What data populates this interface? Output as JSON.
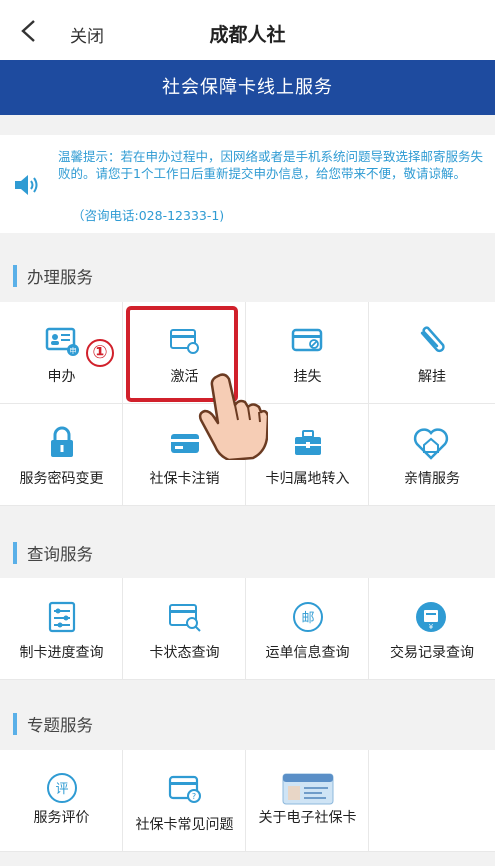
{
  "header": {
    "close_label": "关闭",
    "title": "成都人社"
  },
  "banner": {
    "text": "社会保障卡线上服务"
  },
  "notice": {
    "text": "温馨提示：若在申办过程中，因网络或者是手机系统问题导致选择邮寄服务失败的。请您于1个工作日后重新提交申办信息，给您带来不便，敬请谅解。",
    "tel": "（咨询电话:028-12333-1)"
  },
  "sections": {
    "handle": {
      "title": "办理服务",
      "items": [
        {
          "label": "申办",
          "icon": "id-card-apply-icon"
        },
        {
          "label": "激活",
          "icon": "card-activate-icon"
        },
        {
          "label": "挂失",
          "icon": "card-loss-icon"
        },
        {
          "label": "解挂",
          "icon": "paperclip-icon"
        },
        {
          "label": "服务密码变更",
          "icon": "lock-icon"
        },
        {
          "label": "社保卡注销",
          "icon": "card-cancel-icon"
        },
        {
          "label": "卡归属地转入",
          "icon": "briefcase-icon"
        },
        {
          "label": "亲情服务",
          "icon": "house-heart-icon"
        }
      ]
    },
    "query": {
      "title": "查询服务",
      "items": [
        {
          "label": "制卡进度查询",
          "icon": "progress-sliders-icon"
        },
        {
          "label": "卡状态查询",
          "icon": "card-search-icon"
        },
        {
          "label": "运单信息查询",
          "icon": "post-circle-icon"
        },
        {
          "label": "交易记录查询",
          "icon": "transaction-icon"
        }
      ]
    },
    "special": {
      "title": "专题服务",
      "items": [
        {
          "label": "服务评价",
          "icon": "evaluate-icon"
        },
        {
          "label": "社保卡常见问题",
          "icon": "card-question-icon"
        },
        {
          "label": "关于电子社保卡",
          "icon": "e-card-image-icon"
        }
      ]
    }
  },
  "annotation": {
    "step_number": "①"
  },
  "colors": {
    "brand_blue": "#1e4b9f",
    "icon_blue": "#2f9bd3",
    "highlight_red": "#d1202b"
  }
}
